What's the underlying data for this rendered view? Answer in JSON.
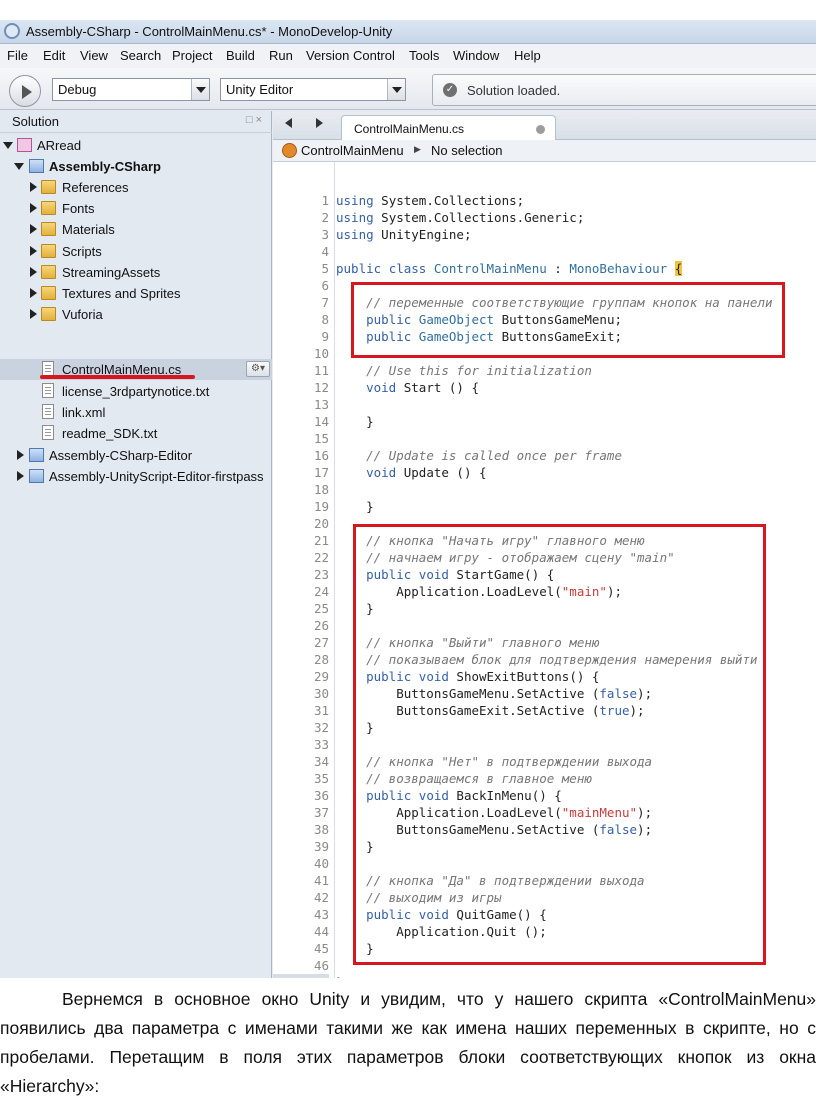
{
  "window": {
    "title": "Assembly-CSharp - ControlMainMenu.cs* - MonoDevelop-Unity"
  },
  "menubar": {
    "items": [
      "File",
      "Edit",
      "View",
      "Search",
      "Project",
      "Build",
      "Run",
      "Version Control",
      "Tools",
      "Window",
      "Help"
    ]
  },
  "toolbar": {
    "configuration": "Debug",
    "target": "Unity Editor",
    "status": "Solution loaded."
  },
  "solution": {
    "title": "Solution",
    "pane_buttons": "□ ×",
    "tree": [
      {
        "label": "ARread",
        "kind": "solution",
        "level": 0,
        "expanded": true
      },
      {
        "label": "Assembly-CSharp",
        "kind": "project",
        "level": 1,
        "expanded": true,
        "bold": true
      },
      {
        "label": "References",
        "kind": "folder",
        "level": 2,
        "expanded": false
      },
      {
        "label": "Fonts",
        "kind": "folder",
        "level": 2,
        "expanded": false
      },
      {
        "label": "Materials",
        "kind": "folder",
        "level": 2,
        "expanded": false
      },
      {
        "label": "Scripts",
        "kind": "folder",
        "level": 2,
        "expanded": false
      },
      {
        "label": "StreamingAssets",
        "kind": "folder",
        "level": 2,
        "expanded": false
      },
      {
        "label": "Textures and Sprites",
        "kind": "folder",
        "level": 2,
        "expanded": false
      },
      {
        "label": "Vuforia",
        "kind": "folder",
        "level": 2,
        "expanded": false
      },
      {
        "label": "ControlMainMenu.cs",
        "kind": "file",
        "level": 2,
        "selected": true
      },
      {
        "label": "license_3rdpartynotice.txt",
        "kind": "file",
        "level": 2
      },
      {
        "label": "link.xml",
        "kind": "file",
        "level": 2
      },
      {
        "label": "readme_SDK.txt",
        "kind": "file",
        "level": 2
      },
      {
        "label": "Assembly-CSharp-Editor",
        "kind": "project",
        "level": 1,
        "expanded": false
      },
      {
        "label": "Assembly-UnityScript-Editor-firstpass",
        "kind": "project",
        "level": 1,
        "expanded": false
      }
    ]
  },
  "editor": {
    "tab_label": "ControlMainMenu.cs",
    "path_class": "ControlMainMenu",
    "path_member": "No selection",
    "lines": [
      "using System.Collections;",
      "using System.Collections.Generic;",
      "using UnityEngine;",
      "",
      "public class ControlMainMenu : MonoBehaviour {",
      "",
      "    // переменные соответствующие группам кнопок на панели",
      "    public GameObject ButtonsGameMenu;",
      "    public GameObject ButtonsGameExit;",
      "",
      "    // Use this for initialization",
      "    void Start () {",
      "",
      "    }",
      "",
      "    // Update is called once per frame",
      "    void Update () {",
      "",
      "    }",
      "",
      "    // кнопка \"Начать игру\" главного меню",
      "    // начнаем игру - отображаем сцену \"main\"",
      "    public void StartGame() {",
      "        Application.LoadLevel(\"main\");",
      "    }",
      "",
      "    // кнопка \"Выйти\" главного меню",
      "    // показываем блок для подтверждения намерения выйти",
      "    public void ShowExitButtons() {",
      "        ButtonsGameMenu.SetActive (false);",
      "        ButtonsGameExit.SetActive (true);",
      "    }",
      "",
      "    // кнопка \"Нет\" в подтверждении выхода",
      "    // возвращаемся в главное меню",
      "    public void BackInMenu() {",
      "        Application.LoadLevel(\"mainMenu\");",
      "        ButtonsGameMenu.SetActive (false);",
      "    }",
      "",
      "    // кнопка \"Да\" в подтверждении выхода",
      "    // выходим из игры",
      "    public void QuitGame() {",
      "        Application.Quit ();",
      "    }",
      "",
      "}"
    ]
  },
  "caption": {
    "paragraph": "Вернемся в основное окно Unity и увидим, что у нашего скрипта «ControlMainMenu» появились два параметра с именами такими же как имена наших переменных в скрипте, но с пробелами. Перетащим в поля этих параметров блоки соответствующих кнопок из окна «Hierarchy»:"
  },
  "colors": {
    "highlight": "#d7171f",
    "keyword": "#3560a8",
    "string": "#c73b3b",
    "comment": "#777777"
  }
}
